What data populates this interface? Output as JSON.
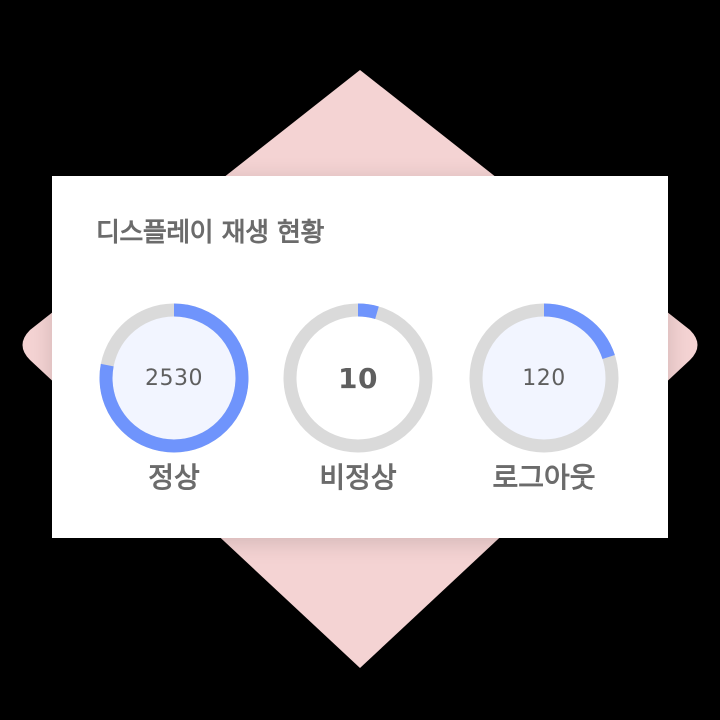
{
  "panel": {
    "title": "디스플레이 재생 현황"
  },
  "colors": {
    "accent": "#6f94fc",
    "track": "#dadada",
    "background_shape": "#f4d3d3",
    "card": "#ffffff",
    "text": "#6b6b6b"
  },
  "gauges": [
    {
      "label": "정상",
      "value": "2530",
      "progress": 0.78,
      "glow": true
    },
    {
      "label": "비정상",
      "value": "10",
      "progress": 0.045,
      "glow": false
    },
    {
      "label": "로그아웃",
      "value": "120",
      "progress": 0.2,
      "glow": true
    }
  ]
}
